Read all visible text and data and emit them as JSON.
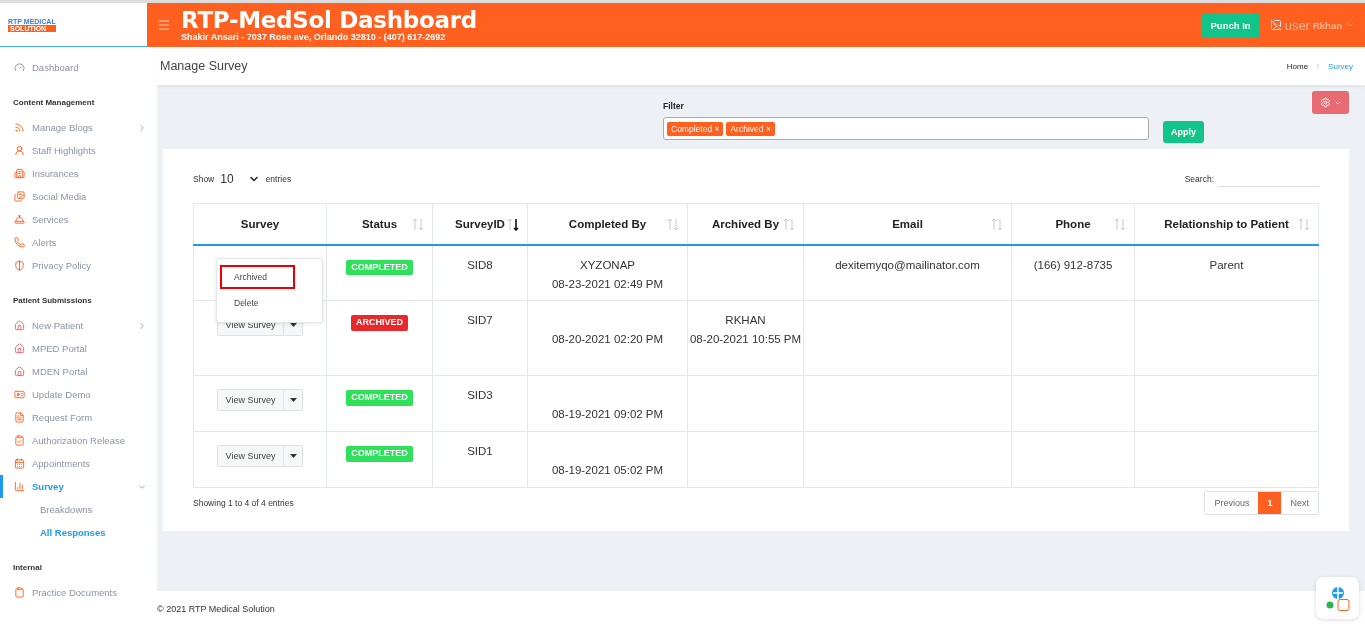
{
  "header": {
    "logo_top": "RTP MEDICAL",
    "logo_bottom": "SOLUTION",
    "title": "RTP-MedSol Dashboard",
    "subtitle": "Shakir Ansari - 7037 Rose ave, Orlando 32810 - (407) 617-2692",
    "punch_button": "Punch In",
    "user_alt": "user",
    "user_name": "Rkhan"
  },
  "sidebar": {
    "top_item": {
      "label": "Dashboard",
      "selected": false
    },
    "sections": [
      {
        "title": "Content Management",
        "items": [
          {
            "label": "Manage Blogs",
            "selected": false,
            "expanded": false
          },
          {
            "label": "Staff Highlights",
            "selected": false
          },
          {
            "label": "Insurances",
            "selected": false
          },
          {
            "label": "Social Media",
            "selected": false
          },
          {
            "label": "Services",
            "selected": false
          },
          {
            "label": "Alerts",
            "selected": false
          },
          {
            "label": "Privacy Policy",
            "selected": false
          }
        ]
      },
      {
        "title": "Patient Submissions",
        "items": [
          {
            "label": "New Patient",
            "selected": false,
            "expanded": false
          },
          {
            "label": "MPED Portal",
            "selected": false
          },
          {
            "label": "MDEN Portal",
            "selected": false
          },
          {
            "label": "Update Demo",
            "selected": false
          },
          {
            "label": "Request Form",
            "selected": false
          },
          {
            "label": "Authorization Release",
            "selected": false
          },
          {
            "label": "Appointments",
            "selected": false
          },
          {
            "label": "Survey",
            "selected": true,
            "expanded": true,
            "children": [
              {
                "label": "Breakdowns",
                "selected": false
              },
              {
                "label": "All Responses",
                "selected": true
              }
            ]
          }
        ]
      },
      {
        "title": "Internal",
        "items": [
          {
            "label": "Practice Documents",
            "selected": false
          }
        ]
      }
    ]
  },
  "page_title": "Manage Survey",
  "breadcrumb": [
    {
      "label": "Home",
      "selected": false
    },
    {
      "label": "Survey",
      "selected": true
    }
  ],
  "filter": {
    "label": "Filter",
    "tags": [
      "Completed",
      "Archived"
    ],
    "remove_mark": "×",
    "apply_button": "Apply"
  },
  "table": {
    "show_label": "Show",
    "page_size": "10",
    "entries_label": "entries",
    "search_label": "Search:",
    "columns": [
      {
        "label": "Survey",
        "sortable": false
      },
      {
        "label": "Status",
        "sortable": true,
        "sorted_desc": false
      },
      {
        "label": "SurveyID",
        "sortable": true,
        "sorted_desc": true
      },
      {
        "label": "Completed By",
        "sortable": true,
        "sorted_desc": false
      },
      {
        "label": "Archived By",
        "sortable": true,
        "sorted_desc": false
      },
      {
        "label": "Email",
        "sortable": true,
        "sorted_desc": false
      },
      {
        "label": "Phone",
        "sortable": true,
        "sorted_desc": false
      },
      {
        "label": "Relationship to Patient",
        "sortable": true,
        "sorted_desc": false
      }
    ],
    "rows": [
      {
        "menu_open": true,
        "status": "COMPLETED",
        "color": "#2ee05a",
        "id": "SID8",
        "completed_by": [
          "XYZONAP",
          "08-23-2021 02:49 PM"
        ],
        "email": "dexitemyqo@mailinator.com",
        "phone": "(166) 912-8735",
        "relationship": "Parent"
      },
      {
        "button": "View Survey",
        "menu_open": false,
        "status": "ARCHIVED",
        "color": "#e8282b",
        "id": "SID7",
        "completed_by": [
          "08-20-2021 02:20 PM"
        ],
        "archived_by": [
          "RKHAN",
          "08-20-2021 10:55 PM"
        ]
      },
      {
        "button": "View Survey",
        "menu_open": false,
        "status": "COMPLETED",
        "color": "#2ee05a",
        "id": "SID3",
        "completed_by": [
          "08-19-2021 09:02 PM"
        ]
      },
      {
        "button": "View Survey",
        "menu_open": false,
        "status": "COMPLETED",
        "color": "#2ee05a",
        "id": "SID1",
        "completed_by": [
          "08-19-2021 05:02 PM"
        ]
      }
    ],
    "row_menu": [
      {
        "label": "Archived",
        "highlighted": true
      },
      {
        "label": "Delete",
        "highlighted": false
      }
    ],
    "info": "Showing 1 to 4 of 4 entries",
    "pagination": [
      {
        "label": "Previous",
        "selected": false
      },
      {
        "label": "1",
        "selected": true
      },
      {
        "label": "Next",
        "selected": false
      }
    ]
  },
  "footer": "© 2021 RTP Medical Solution"
}
